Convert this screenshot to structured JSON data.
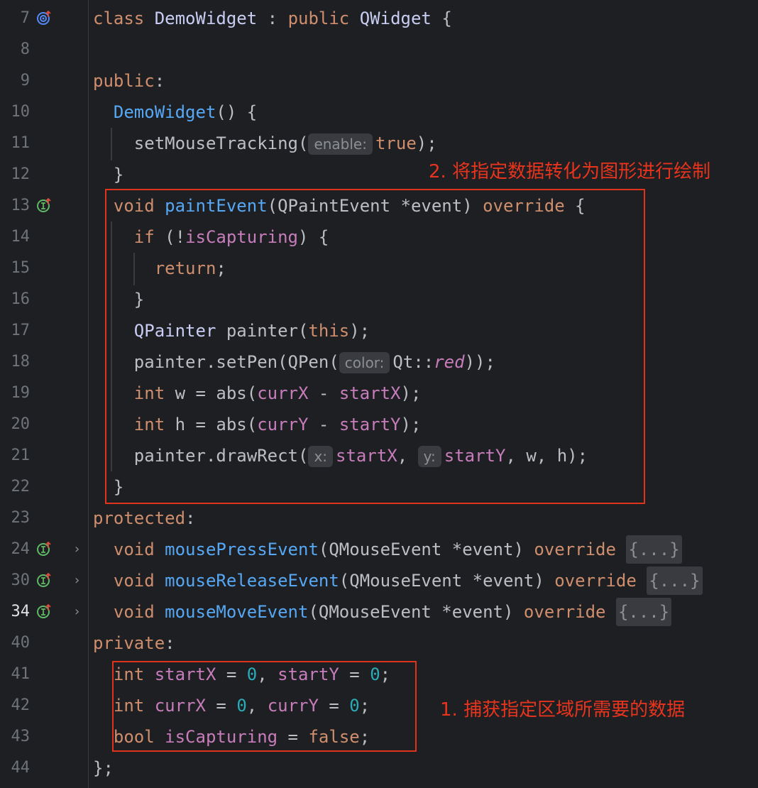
{
  "lines": [
    {
      "num": "7"
    },
    {
      "num": "8"
    },
    {
      "num": "9"
    },
    {
      "num": "10"
    },
    {
      "num": "11"
    },
    {
      "num": "12"
    },
    {
      "num": "13"
    },
    {
      "num": "14"
    },
    {
      "num": "15"
    },
    {
      "num": "16"
    },
    {
      "num": "17"
    },
    {
      "num": "18"
    },
    {
      "num": "19"
    },
    {
      "num": "20"
    },
    {
      "num": "21"
    },
    {
      "num": "22"
    },
    {
      "num": "23"
    },
    {
      "num": "24"
    },
    {
      "num": "30"
    },
    {
      "num": "34"
    },
    {
      "num": "40"
    },
    {
      "num": "41"
    },
    {
      "num": "42"
    },
    {
      "num": "43"
    },
    {
      "num": "44"
    }
  ],
  "code": {
    "class_kw": "class",
    "class_name": "DemoWidget",
    "colon": " : ",
    "public_kw": "public",
    "base": "QWidget",
    "open": " {",
    "public_label": "public",
    "ctor": "DemoWidget",
    "ctor_tail": "() {",
    "set_mouse": "setMouseTracking(",
    "hint_enable": "enable:",
    "true_kw": "true",
    "close_paren_semi": ");",
    "close_brace": "}",
    "void_kw": "void",
    "paint_fn": "paintEvent",
    "paint_args": "(QPaintEvent *event) ",
    "override_kw": "override",
    "if_kw": "if",
    "if_open": " (!",
    "is_capturing": "isCapturing",
    "if_close": ") {",
    "return_kw": "return",
    "semi": ";",
    "qpainter": "QPainter",
    "painter_decl": " painter(",
    "this_kw": "this",
    "set_pen": "painter.setPen(QPen(",
    "hint_color": "color:",
    "qt": "Qt::",
    "red": "red",
    "double_close": "));",
    "int_kw": "int",
    "w_assign": " w = abs(",
    "h_assign": " h = abs(",
    "currX": "currX",
    "currY": "currY",
    "minus": " - ",
    "startX": "startX",
    "startY": "startY",
    "draw_rect": "painter.drawRect(",
    "hint_x": "x:",
    "hint_y": "y:",
    "comma": ", ",
    "wh_tail": ", w, h);",
    "protected_label": "protected",
    "mouse_press": "mousePressEvent",
    "mouse_release": "mouseReleaseEvent",
    "mouse_move": "mouseMoveEvent",
    "mouse_args": "(QMouseEvent *event) ",
    "folded": "{...}",
    "private_label": "private",
    "assign_zero": " = ",
    "zero": "0",
    "bool_kw": "bool",
    "false_kw": "false",
    "end": "};"
  },
  "annotations": {
    "note_top": "2. 将指定数据转化为图形进行绘制",
    "note_bottom": "1. 捕获指定区域所需要的数据"
  },
  "colors": {
    "annotation": "#e0331b"
  }
}
